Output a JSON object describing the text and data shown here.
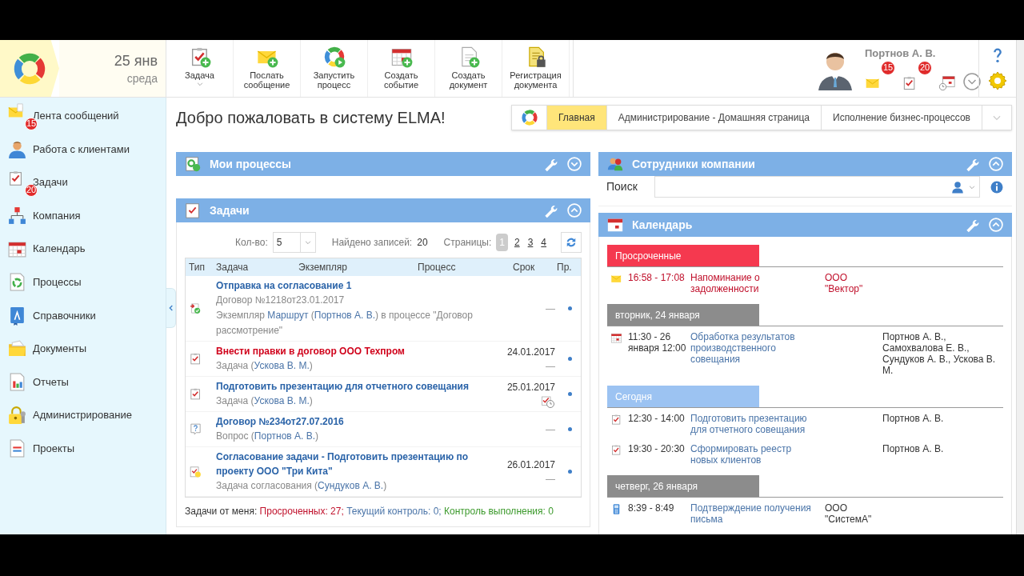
{
  "header": {
    "date": "25 янв",
    "weekday": "среда",
    "toolbar": [
      {
        "label": "Задача",
        "has_menu": true
      },
      {
        "label": "Послать сообщение",
        "has_menu": false
      },
      {
        "label": "Запустить процесс",
        "has_menu": false
      },
      {
        "label": "Создать событие",
        "has_menu": false
      },
      {
        "label": "Создать документ",
        "has_menu": false
      },
      {
        "label": "Регистрация документа",
        "has_menu": false
      }
    ],
    "user": {
      "name": "Портнов А. В.",
      "messages_badge": "15",
      "tasks_badge": "20"
    }
  },
  "sidebar": {
    "items": [
      {
        "label": "Лента сообщений",
        "badge": "15"
      },
      {
        "label": "Работа с клиентами"
      },
      {
        "label": "Задачи",
        "badge": "20"
      },
      {
        "label": "Компания"
      },
      {
        "label": "Календарь"
      },
      {
        "label": "Процессы"
      },
      {
        "label": "Справочники"
      },
      {
        "label": "Документы"
      },
      {
        "label": "Отчеты"
      },
      {
        "label": "Администрирование"
      },
      {
        "label": "Проекты"
      }
    ]
  },
  "page_title": "Добро пожаловать в систему ELMA!",
  "tabs": [
    {
      "label": "Главная",
      "selected": true
    },
    {
      "label": "Администрирование - Домашняя страница",
      "selected": false
    },
    {
      "label": "Исполнение бизнес-процессов",
      "selected": false
    }
  ],
  "my_processes": {
    "title": "Мои процессы",
    "expanded": false
  },
  "tasks": {
    "title": "Задачи",
    "expanded": true,
    "count_label": "Кол-во:",
    "count_value": "5",
    "found_label": "Найдено записей:",
    "found_value": "20",
    "pages_label": "Страницы:",
    "pages": [
      {
        "label": "1",
        "selected": true
      },
      {
        "label": "2",
        "selected": false
      },
      {
        "label": "3",
        "selected": false
      },
      {
        "label": "4",
        "selected": false
      }
    ],
    "columns": [
      "Тип",
      "Задача",
      "Экземпляр",
      "Процесс",
      "Срок",
      "Пр."
    ],
    "rows": [
      {
        "kind": "approval",
        "title": "Отправка на согласование 1",
        "overdue": false,
        "lines": [
          [
            {
              "text": "Договор №1218от23.01.2017",
              "link": false
            }
          ],
          [
            {
              "text": "Экземпляр ",
              "link": false
            },
            {
              "text": "Маршрут",
              "link": true
            },
            {
              "text": " (",
              "link": false
            },
            {
              "text": "Портнов А. В.",
              "link": true
            },
            {
              "text": ") в процессе \"Договор рассмотрение\"",
              "link": false
            }
          ]
        ],
        "note": "—",
        "late_icon": false
      },
      {
        "kind": "task",
        "title": "Внести правки в договор ООО Техпром",
        "overdue": true,
        "lines": [
          [
            {
              "text": "Задача (",
              "link": false
            },
            {
              "text": "Ускова В. М.",
              "link": true
            },
            {
              "text": ")",
              "link": false
            }
          ]
        ],
        "due": "24.01.2017",
        "note": "—",
        "late_icon": false
      },
      {
        "kind": "task",
        "title": "Подготовить презентацию для отчетного совещания",
        "overdue": false,
        "lines": [
          [
            {
              "text": "Задача (",
              "link": false
            },
            {
              "text": "Ускова В. М.",
              "link": true
            },
            {
              "text": ")",
              "link": false
            }
          ]
        ],
        "due": "25.01.2017",
        "late_icon": true
      },
      {
        "kind": "question",
        "title": "Договор №234от27.07.2016",
        "overdue": false,
        "lines": [
          [
            {
              "text": "Вопрос (",
              "link": false
            },
            {
              "text": "Портнов А. В.",
              "link": true
            },
            {
              "text": ")",
              "link": false
            }
          ]
        ],
        "note": "—",
        "late_icon": false
      },
      {
        "kind": "task_approval",
        "title": "Согласование задачи - Подготовить презентацию по проекту ООО \"Три Кита\"",
        "overdue": false,
        "lines": [
          [
            {
              "text": "Задача согласования (",
              "link": false
            },
            {
              "text": "Сундуков А. В.",
              "link": true
            },
            {
              "text": ")",
              "link": false
            }
          ]
        ],
        "due": "26.01.2017",
        "note": "—",
        "late_icon": false
      }
    ],
    "footer": [
      {
        "text": "Задачи от меня: ",
        "color": "#333333"
      },
      {
        "text": "Просроченных: 27;",
        "color": "#c0102b"
      },
      {
        "text": " Текущий контроль: 0;",
        "color": "#4a74a8"
      },
      {
        "text": " Контроль выполнения: 0",
        "color": "#3c9a2c"
      }
    ]
  },
  "employees": {
    "title": "Сотрудники компании",
    "expanded": true,
    "search_label": "Поиск"
  },
  "calendar": {
    "title": "Календарь",
    "expanded": true,
    "groups": [
      {
        "label": "Просроченные",
        "kind": "overdue",
        "events": [
          {
            "kind": "message",
            "time": "16:58 - 17:08",
            "title": "Напоминание о задолженности",
            "org": "ООО \"Вектор\""
          }
        ]
      },
      {
        "label": "вторник, 24 января",
        "kind": "past",
        "events": [
          {
            "kind": "event",
            "time": "11:30 - 26 января 12:00",
            "title": "Обработка результатов производственного совещания",
            "people": "Портнов А. В., Самохвалова Е. В., Сундуков А. В., Ускова В. М."
          }
        ]
      },
      {
        "label": "Сегодня",
        "kind": "today",
        "events": [
          {
            "kind": "task",
            "time": "12:30 - 14:00",
            "title": "Подготовить презентацию для отчетного совещания",
            "people": "Портнов А. В."
          },
          {
            "kind": "task",
            "time": "19:30 - 20:30",
            "title": "Сформировать реестр новых клиентов",
            "people": "Портнов А. В."
          }
        ]
      },
      {
        "label": "четверг, 26 января",
        "kind": "future",
        "events": [
          {
            "kind": "call",
            "time": "8:39 - 8:49",
            "title": "Подтверждение получения письма",
            "org": "ООО \"СистемА\""
          }
        ]
      }
    ]
  }
}
